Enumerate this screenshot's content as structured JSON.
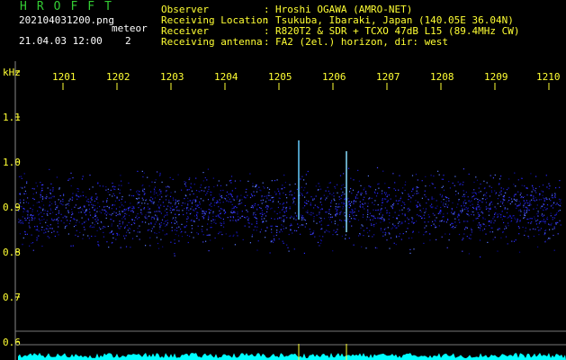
{
  "header": {
    "title": "HROFFT",
    "filename": "202104031200.png",
    "datetime": "21.04.03 12:00",
    "meteor_label": "meteor",
    "meteor_count": "2"
  },
  "meta": [
    {
      "key": "Observer",
      "value": "Hroshi OGAWA (AMRO-NET)"
    },
    {
      "key": "Receiving Location",
      "value": "Tsukuba, Ibaraki, Japan (140.05E 36.04N)"
    },
    {
      "key": "Receiver",
      "value": "R820T2 & SDR + TCXO 47dB L15 (89.4MHz CW)"
    },
    {
      "key": "Receiving antenna",
      "value": "FA2 (2el.) horizon, dir: west"
    }
  ],
  "axis": {
    "unit": "kHz",
    "y_ticks": [
      "1.1",
      "1.0",
      "0.9",
      "0.8",
      "0.7",
      "0.6"
    ],
    "x_ticks": [
      "1201",
      "1202",
      "1203",
      "1204",
      "1205",
      "1206",
      "1207",
      "1208",
      "1209",
      "1210"
    ]
  },
  "colors": {
    "label": "#ffff33",
    "title": "#33cc33",
    "noise": "#1a1aff",
    "echo": "#66ccff",
    "baseline": "#00ffff"
  },
  "echoes": [
    {
      "time": "1205.4"
    },
    {
      "time": "1206.3"
    }
  ]
}
